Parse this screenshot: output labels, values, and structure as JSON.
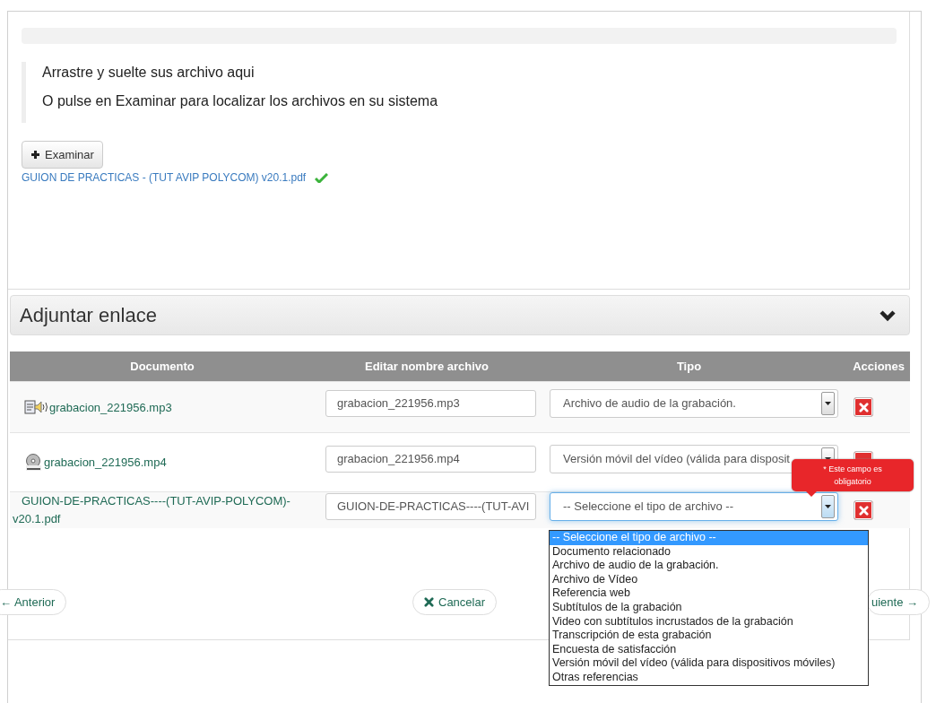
{
  "upload": {
    "instructions": [
      "Arrastre y suelte sus archivo aqui",
      "O pulse en Examinar para localizar los archivos en su sistema"
    ],
    "browse_button": "Examinar",
    "uploaded_file": {
      "name": "GUION DE PRACTICAS - (TUT AVIP POLYCOM) v20.1.pdf",
      "uploaded": true
    }
  },
  "link_section": {
    "title": "Adjuntar enlace"
  },
  "table": {
    "columns": [
      "Documento",
      "Editar nombre archivo",
      "Tipo",
      "Acciones"
    ],
    "rows": [
      {
        "kind": "audio",
        "document": "grabacion_221956.mp3",
        "name_value": "grabacion_221956.mp3",
        "type_value": "Archivo de audio de la grabación.",
        "focused": false
      },
      {
        "kind": "video",
        "document": "grabacion_221956.mp4",
        "name_value": "grabacion_221956.mp4",
        "type_value": "Versión móvil del vídeo (válida para disposit",
        "focused": false
      },
      {
        "kind": "plain",
        "document": "GUION-DE-PRACTICAS----(TUT-AVIP-POLYCOM)-v20.1.pdf",
        "name_value": "GUION-DE-PRACTICAS----(TUT-AVI",
        "type_value": "-- Seleccione el tipo de archivo --",
        "focused": true
      }
    ],
    "validation_message": "* Este campo es obligatorio",
    "dropdown_options": [
      {
        "label": "-- Seleccione el tipo de archivo --",
        "selected": true
      },
      {
        "label": "Documento relacionado",
        "selected": false
      },
      {
        "label": "Archivo de audio de la grabación.",
        "selected": false
      },
      {
        "label": "Archivo de Vídeo",
        "selected": false
      },
      {
        "label": "Referencia web",
        "selected": false
      },
      {
        "label": "Subtítulos de la grabación",
        "selected": false
      },
      {
        "label": "Video con subtítulos incrustados de la grabación",
        "selected": false
      },
      {
        "label": "Transcripción de esta grabación",
        "selected": false
      },
      {
        "label": "Encuesta de satisfacción",
        "selected": false
      },
      {
        "label": "Versión móvil del vídeo (válida para dispositivos móviles)",
        "selected": false
      },
      {
        "label": "Otras referencias",
        "selected": false
      }
    ]
  },
  "navigation": {
    "previous": "← Anterior",
    "cancel": "Cancelar",
    "next": "uiente →"
  }
}
